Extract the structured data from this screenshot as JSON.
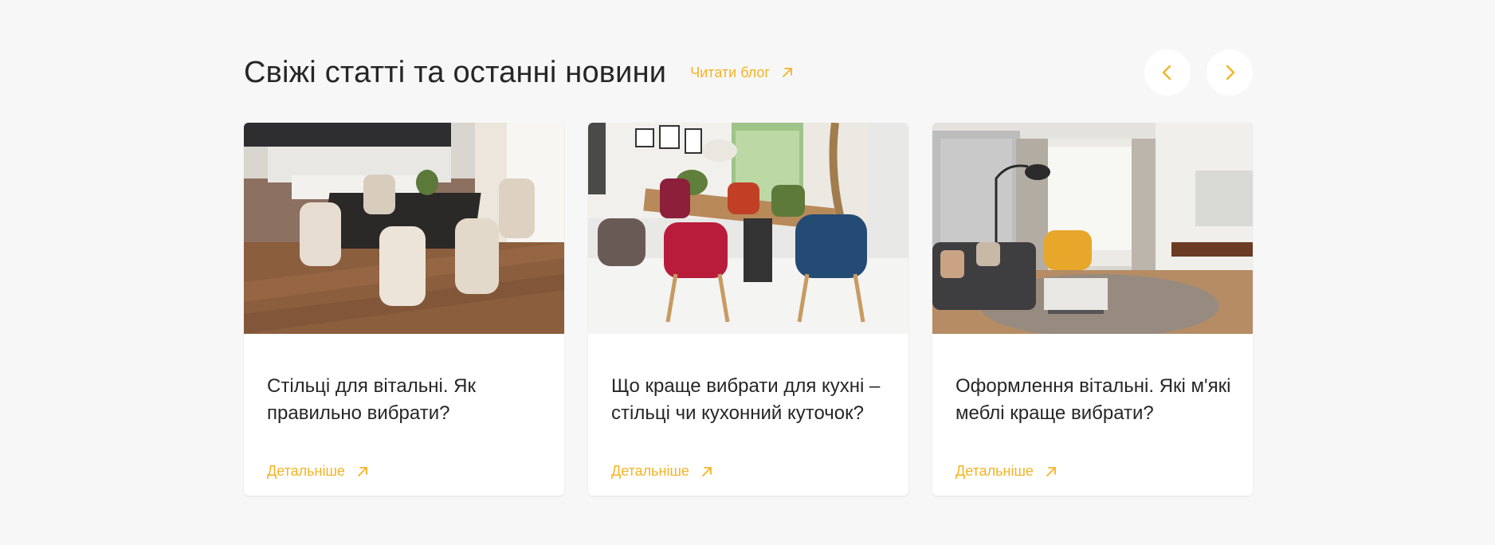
{
  "header": {
    "title": "Свіжі статті та останні новини",
    "blog_link": "Читати блог"
  },
  "nav": {
    "prev_icon": "chevron-left-icon",
    "next_icon": "chevron-right-icon"
  },
  "cards": [
    {
      "title": "Стільці для вітальні. Як правильно вибрати?",
      "link": "Детальніше",
      "image": "dining-room-white-chairs"
    },
    {
      "title": "Що краще вибрати для кухні – стільці чи кухонний куточок?",
      "link": "Детальніше",
      "image": "dining-table-colorful-chairs"
    },
    {
      "title": "Оформлення вітальні. Які м'які меблі краще вибрати?",
      "link": "Детальніше",
      "image": "living-room-sofa-yellow-armchair"
    }
  ],
  "colors": {
    "accent": "#f5b324",
    "background": "#f7f7f7",
    "card": "#ffffff",
    "text": "#262626"
  }
}
